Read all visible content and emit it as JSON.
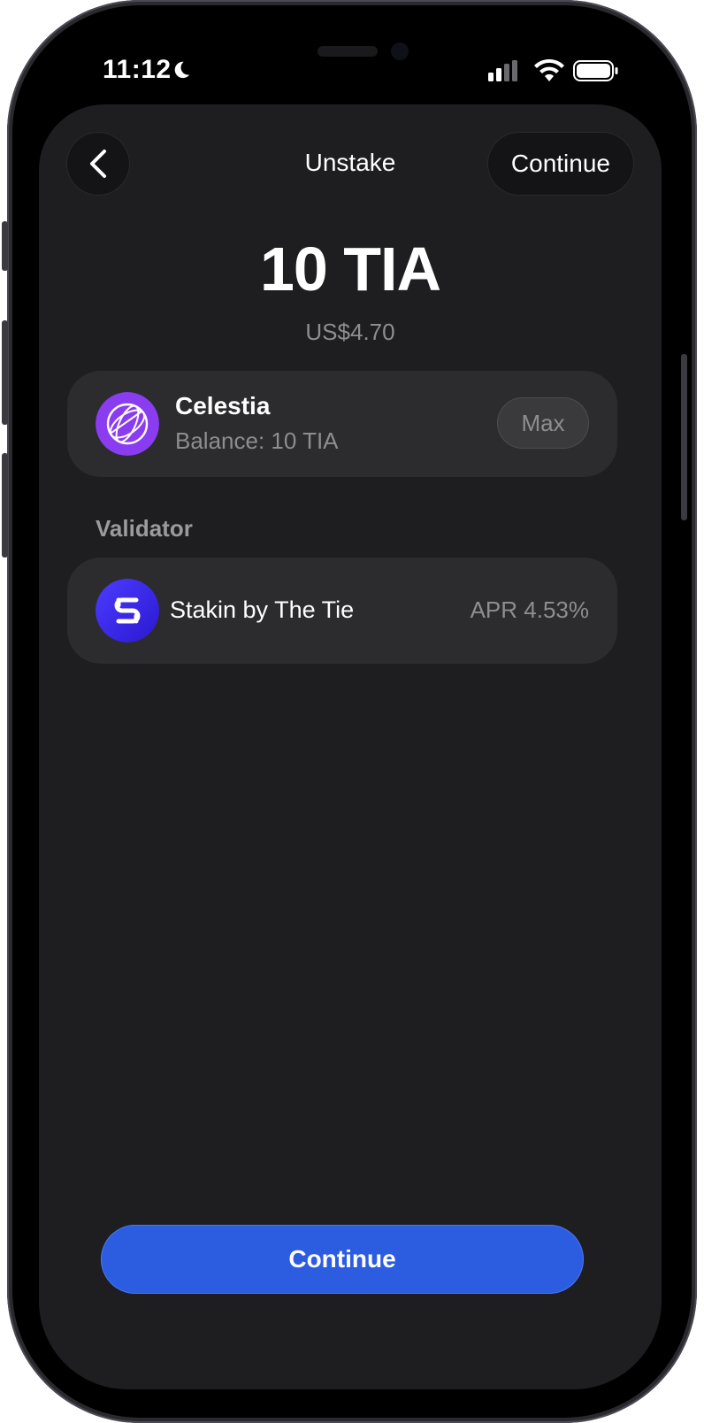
{
  "status_bar": {
    "time": "11:12"
  },
  "header": {
    "title": "Unstake",
    "continue_label": "Continue"
  },
  "amount": {
    "value": "10 TIA",
    "fiat": "US$4.70"
  },
  "asset": {
    "name": "Celestia",
    "balance": "Balance: 10 TIA",
    "max_label": "Max",
    "logo_color": "#8a3cf0"
  },
  "validator": {
    "section_label": "Validator",
    "name": "Stakin by The Tie",
    "apr": "APR 4.53%",
    "logo_color": "#3a2cf0"
  },
  "footer": {
    "continue_label": "Continue",
    "accent_color": "#2c5ce0"
  }
}
